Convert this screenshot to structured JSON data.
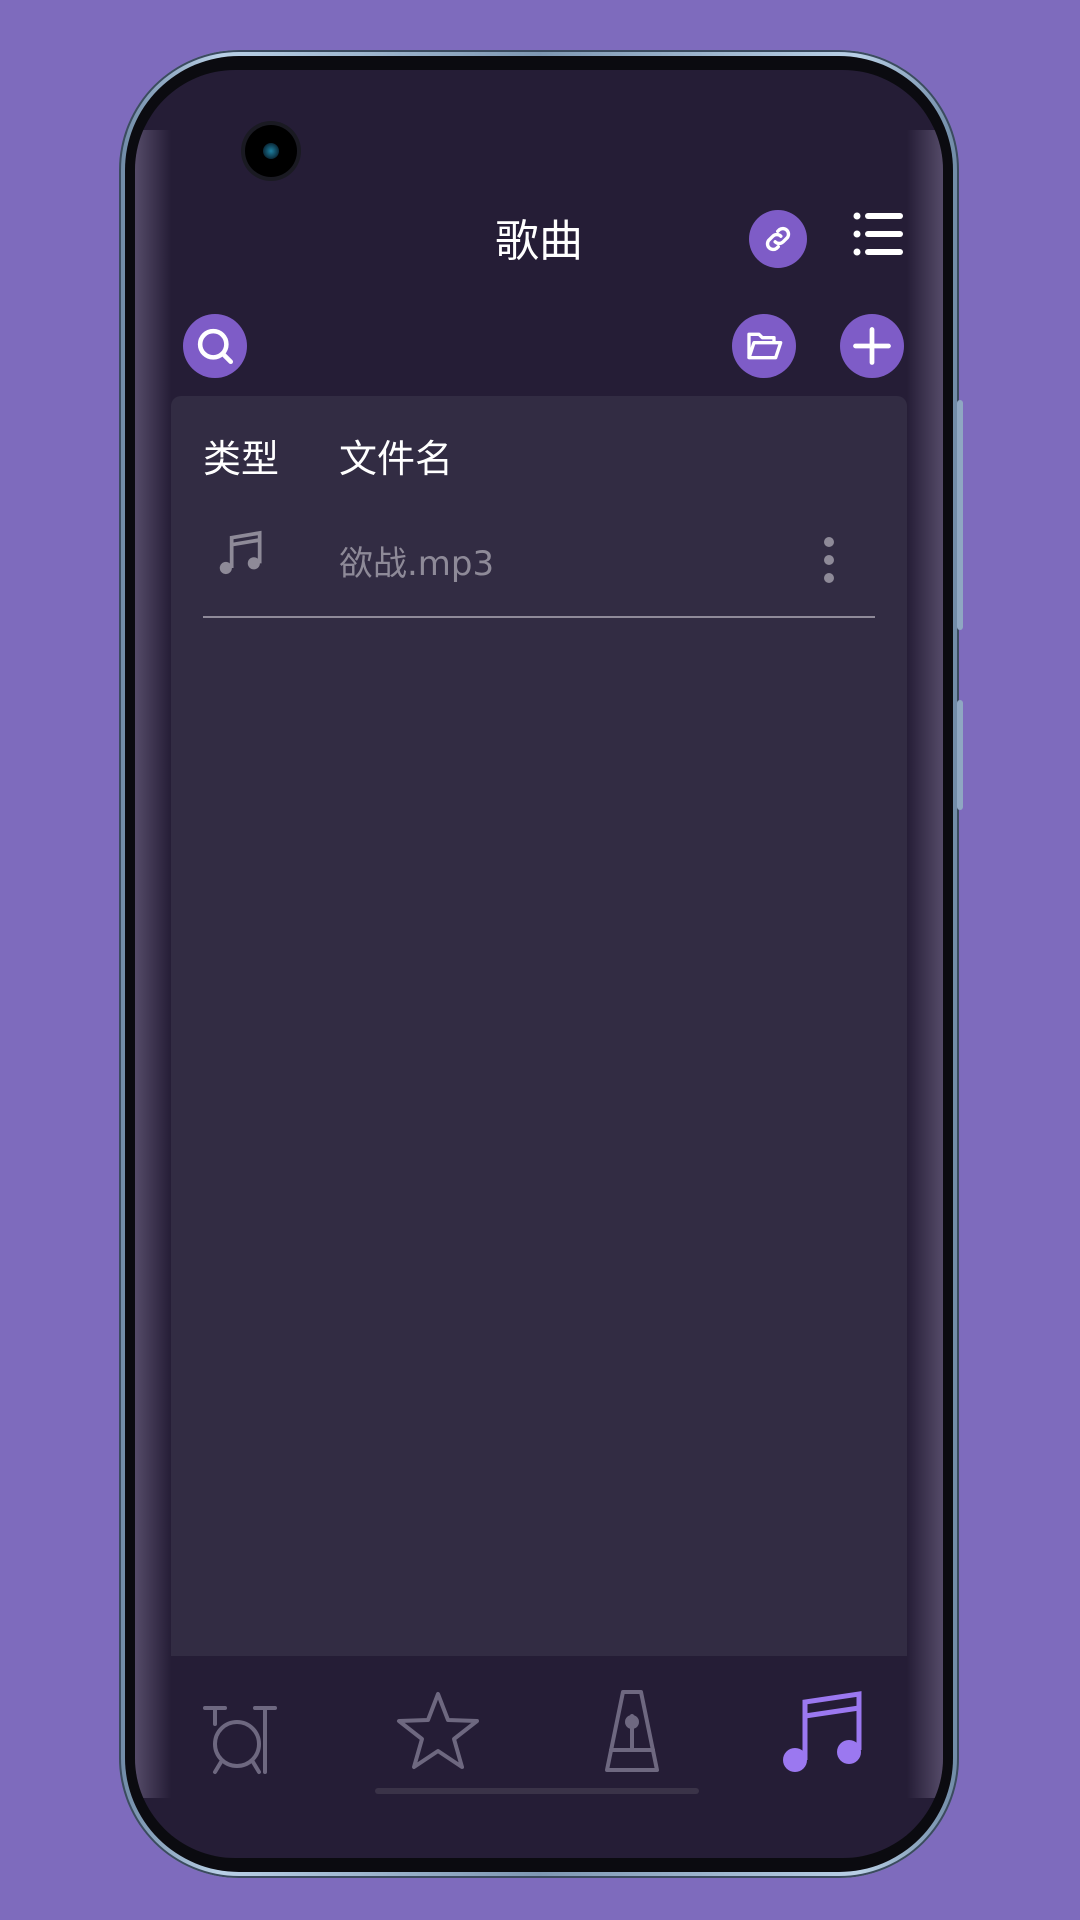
{
  "header": {
    "title": "歌曲"
  },
  "table": {
    "columns": [
      "类型",
      "文件名"
    ],
    "rows": [
      {
        "type_icon": "music-note-icon",
        "filename": "欲战.mp3"
      }
    ]
  },
  "toolbar": {
    "link": "link-icon",
    "menu": "list-menu-icon",
    "search": "search-icon",
    "folder": "folder-open-icon",
    "add": "plus-icon"
  },
  "bottom_nav": {
    "items": [
      {
        "icon": "drum-kit-icon",
        "active": false
      },
      {
        "icon": "star-icon",
        "active": false
      },
      {
        "icon": "metronome-icon",
        "active": false
      },
      {
        "icon": "music-note-icon",
        "active": true
      }
    ]
  },
  "colors": {
    "background": "#7e6bbd",
    "screen": "#251d36",
    "panel": "#322c43",
    "accent": "#7e5cc7",
    "active_nav": "#9b78f0",
    "inactive_nav": "#6e6880"
  }
}
